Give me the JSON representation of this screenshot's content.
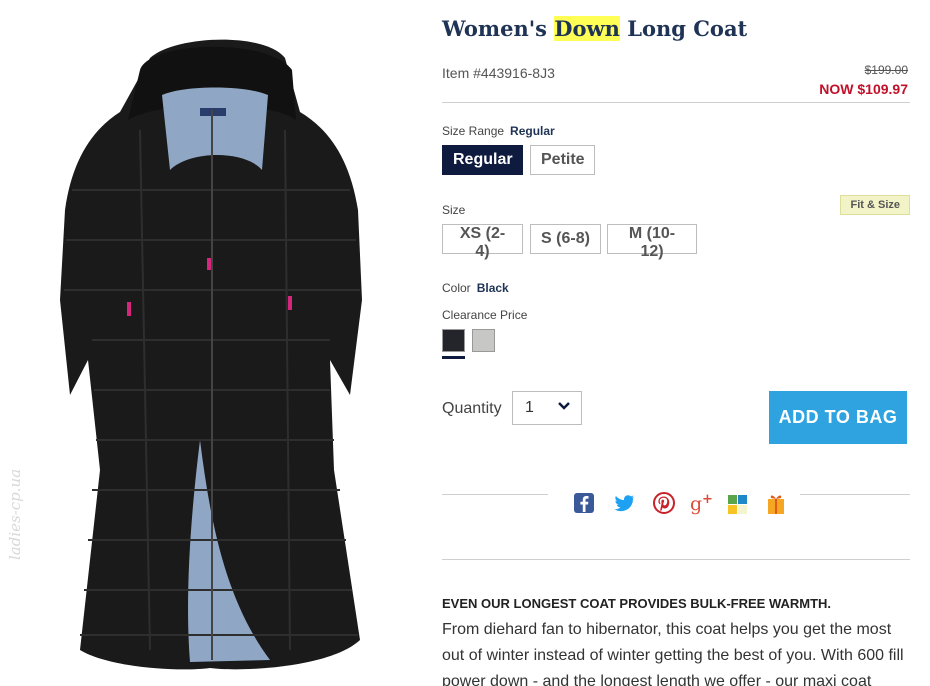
{
  "product": {
    "title_prefix": "Women's",
    "title_highlight": "Down",
    "title_suffix": "Long Coat",
    "item_number": "Item #443916-8J3",
    "price_original": "$199.00",
    "price_now": "NOW $109.97"
  },
  "size_range": {
    "label": "Size Range",
    "selected": "Regular",
    "options": [
      "Regular",
      "Petite"
    ]
  },
  "size": {
    "label": "Size",
    "fit_link": "Fit & Size",
    "options": [
      "XS (2-4)",
      "S (6-8)",
      "M (10-12)"
    ]
  },
  "color": {
    "label": "Color",
    "selected": "Black",
    "note": "Clearance Price",
    "swatches": [
      {
        "name": "Black",
        "hex": "#23252b"
      },
      {
        "name": "Gray",
        "hex": "#c7c7c5"
      }
    ]
  },
  "quantity": {
    "label": "Quantity",
    "value": "1"
  },
  "cart": {
    "add_label": "ADD TO BAG"
  },
  "share": {
    "icons": [
      "facebook-icon",
      "twitter-icon",
      "pinterest-icon",
      "google-plus-icon",
      "windows-live-icon",
      "gift-icon"
    ]
  },
  "description": {
    "heading": "EVEN OUR LONGEST COAT PROVIDES BULK-FREE WARMTH.",
    "body": "From diehard fan to hibernator, this coat helps you get the most out of winter instead of winter getting the best of you. With 600 fill power down - and the longest length we offer - our maxi coat"
  },
  "watermark": "ladies-cp.ua",
  "colors": {
    "navy": "#0f1b3e",
    "title": "#1f3355",
    "sale_red": "#c0102a",
    "accent_blue": "#2ea3e0",
    "highlight": "#ffff55"
  }
}
